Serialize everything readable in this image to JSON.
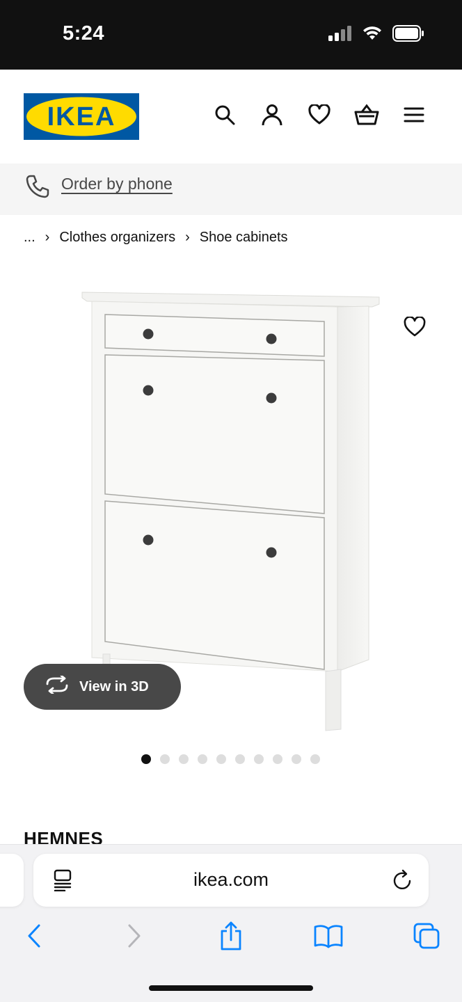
{
  "status_bar": {
    "time": "5:24",
    "icons": [
      "cellular-signal-icon",
      "wifi-icon",
      "battery-icon"
    ]
  },
  "header": {
    "logo_text": "IKEA",
    "logo_colors": {
      "background": "#0058A3",
      "oval": "#FFDB00",
      "text": "#0058A3"
    },
    "icons": [
      "search-icon",
      "account-icon",
      "heart-icon",
      "shopping-basket-icon",
      "menu-icon"
    ]
  },
  "phone_bar": {
    "label": "Order by phone"
  },
  "breadcrumb": {
    "items": [
      "...",
      "Clothes organizers",
      "Shoe cabinets"
    ]
  },
  "product": {
    "image_alt": "White shoe cabinet with 2 compartments and top drawer",
    "view_3d_label": "View in 3D",
    "image_count": 10,
    "active_image_index": 0,
    "name": "HEMNES"
  },
  "browser": {
    "url": "ikea.com",
    "nav_icons": [
      "back-icon",
      "forward-icon",
      "share-icon",
      "bookmarks-icon",
      "tabs-icon"
    ],
    "accent": "#0A84FF"
  }
}
